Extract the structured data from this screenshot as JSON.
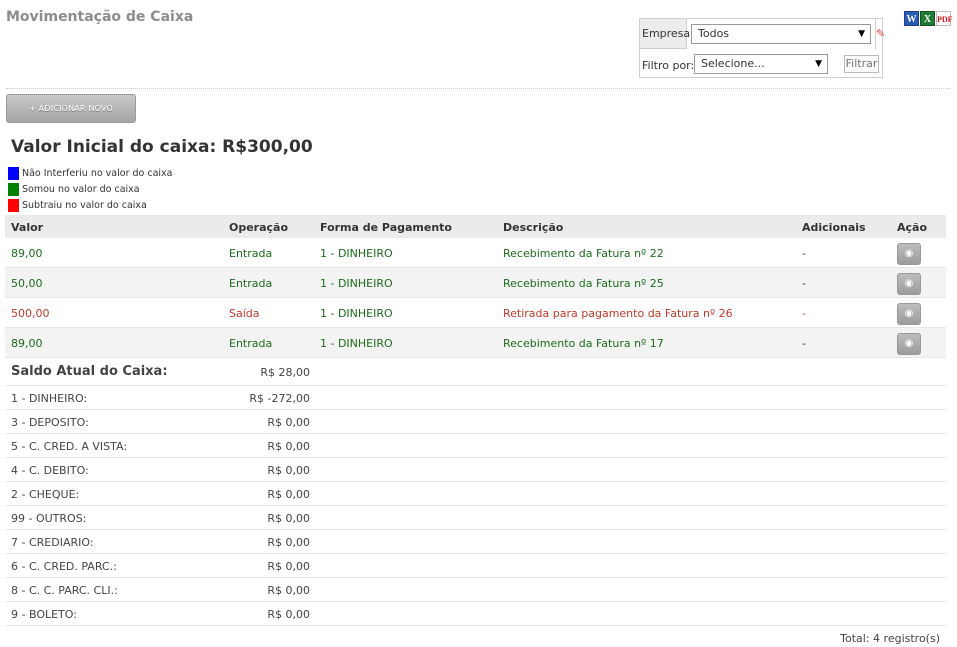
{
  "page": {
    "title": "Movimentação de Caixa"
  },
  "export": {
    "word": "W",
    "excel": "X",
    "pdf": "PDF"
  },
  "filters": {
    "empresa_label": "Empresa",
    "empresa_value": "Todos",
    "filtro_label": "Filtro por:",
    "filtro_value": "Selecione...",
    "filtrar_button": "Filtrar"
  },
  "add_button": "+ ADICIONAR NOVO",
  "valor_inicial": "Valor Inicial do caixa: R$300,00",
  "legend": [
    {
      "color": "#0000ff",
      "label": "Não Interferiu no valor do caixa"
    },
    {
      "color": "#008000",
      "label": "Somou no valor do caixa"
    },
    {
      "color": "#ff0000",
      "label": "Subtraiu no valor do caixa"
    }
  ],
  "table": {
    "headers": [
      "Valor",
      "Operação",
      "Forma de Pagamento",
      "Descrição",
      "Adicionais",
      "Ação"
    ],
    "rows": [
      {
        "valor": "89,00",
        "operacao": "Entrada",
        "forma": "1 - DINHEIRO",
        "descricao": "Recebimento da Fatura nº 22",
        "adicionais": "-",
        "tone": "green"
      },
      {
        "valor": "50,00",
        "operacao": "Entrada",
        "forma": "1 - DINHEIRO",
        "descricao": "Recebimento da Fatura nº 25",
        "adicionais": "-",
        "tone": "green"
      },
      {
        "valor": "500,00",
        "operacao": "Saída",
        "forma": "1 - DINHEIRO",
        "descricao": "Retirada para pagamento da Fatura nº 26",
        "adicionais": "-",
        "tone": "red"
      },
      {
        "valor": "89,00",
        "operacao": "Entrada",
        "forma": "1 - DINHEIRO",
        "descricao": "Recebimento da Fatura nº 17",
        "adicionais": "-",
        "tone": "green"
      }
    ],
    "view_icon": "eye-icon"
  },
  "saldo": {
    "title": "Saldo Atual do Caixa:",
    "total": "R$ 28,00",
    "items": [
      {
        "label": "1 - DINHEIRO:",
        "value": "R$ -272,00"
      },
      {
        "label": "3 - DEPOSITO:",
        "value": "R$ 0,00"
      },
      {
        "label": "5 - C. CRED. A VISTA:",
        "value": "R$ 0,00"
      },
      {
        "label": "4 - C. DEBITO:",
        "value": "R$ 0,00"
      },
      {
        "label": "2 - CHEQUE:",
        "value": "R$ 0,00"
      },
      {
        "label": "99 - OUTROS:",
        "value": "R$ 0,00"
      },
      {
        "label": "7 - CREDIARIO:",
        "value": "R$ 0,00"
      },
      {
        "label": "6 - C. CRED. PARC.:",
        "value": "R$ 0,00"
      },
      {
        "label": "8 - C. C. PARC. CLI.:",
        "value": "R$ 0,00"
      },
      {
        "label": "9 - BOLETO:",
        "value": "R$ 0,00"
      }
    ]
  },
  "footer": {
    "total_registros": "Total: 4 registro(s)"
  }
}
